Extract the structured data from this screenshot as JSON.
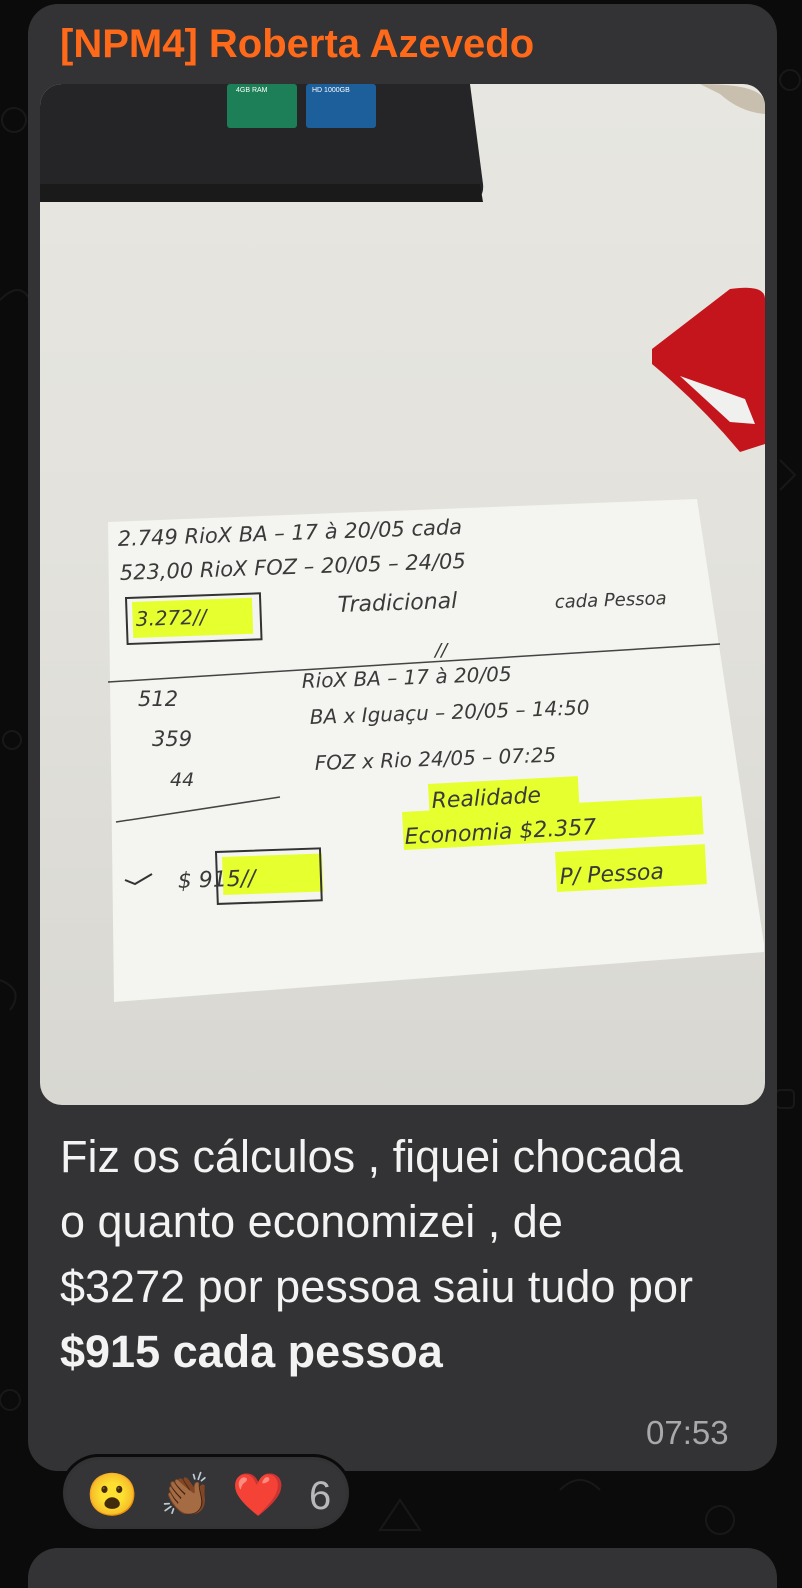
{
  "message": {
    "sender": "[NPM4] Roberta Azevedo",
    "text_plain": "Fiz os cálculos , fiquei chocada o quanto economizei , de $3272 por pessoa saiu tudo por ",
    "text_bold": "$915 cada pessoa",
    "time": "07:53"
  },
  "photo": {
    "laptop_labels": [
      "4GB RAM",
      "HD 1000GB"
    ],
    "note_lines": [
      "2.749   RioX BA  – 17 à 20/05   cada",
      "523,00  RioX FOZ  – 20/05 – 24/05",
      "3.272//",
      "Tradicional",
      "cada Pessoa",
      "//",
      "512",
      "359",
      "44",
      "RioX BA  – 17 à 20/05",
      "BA x Iguaçu – 20/05 – 14:50",
      "FOZ x Rio  24/05 – 07:25",
      "Realidade",
      "Economia $2.357",
      "P/ Pessoa",
      "$ 915//"
    ]
  },
  "reactions": {
    "emojis": [
      {
        "name": "surprised-face-icon",
        "glyph": "😮"
      },
      {
        "name": "clapping-hands-icon",
        "glyph": "👏🏾"
      },
      {
        "name": "red-heart-icon",
        "glyph": "❤️"
      }
    ],
    "count": "6"
  },
  "colors": {
    "sender": "#ff6a1a",
    "bubble": "#333234",
    "background": "#0b0b0b",
    "highlight": "#e6ff2e"
  }
}
